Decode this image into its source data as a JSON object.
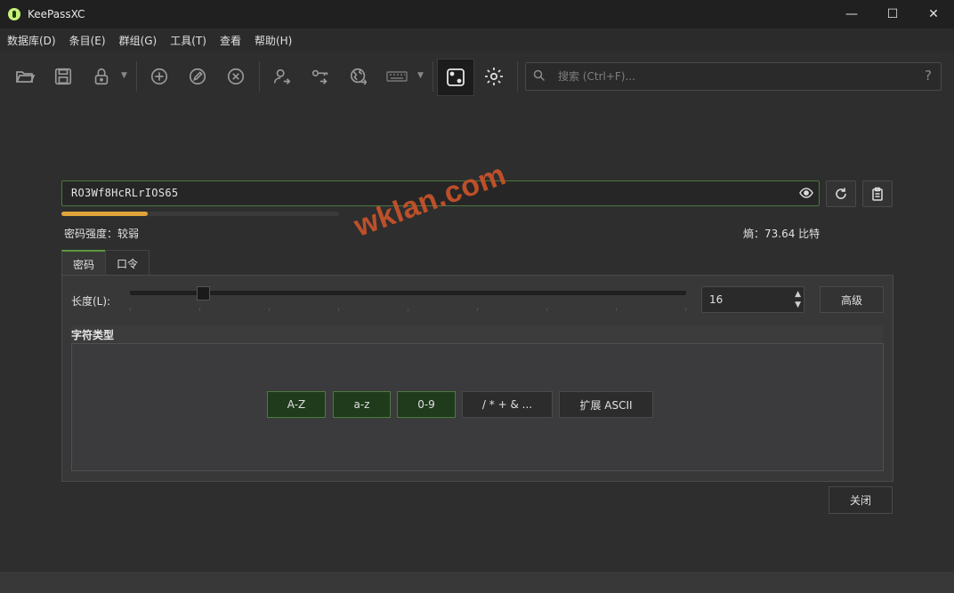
{
  "window": {
    "title": "KeePassXC",
    "minimize": "—",
    "maximize": "☐",
    "close": "✕"
  },
  "menu": [
    "数据库(D)",
    "条目(E)",
    "群组(G)",
    "工具(T)",
    "查看",
    "帮助(H)"
  ],
  "toolbar": {
    "icons": [
      "folder-open-icon",
      "save-icon",
      "lock-icon",
      "add-entry-icon",
      "edit-entry-icon",
      "delete-entry-icon",
      "copy-username-icon",
      "copy-password-icon",
      "open-url-icon",
      "autotype-keyboard-icon",
      "password-generator-icon",
      "settings-icon"
    ],
    "active": "password-generator-icon"
  },
  "search": {
    "placeholder": "搜索 (Ctrl+F)...",
    "help": "?"
  },
  "generator": {
    "password": "RO3Wf8HcRLrIOS65",
    "strength_label": "密码强度：较弱",
    "strength_fraction": 0.31,
    "entropy_label": "熵：73.64 比特",
    "watermark": "wklan.com",
    "tabs": [
      "密码",
      "口令"
    ],
    "active_tab": "密码",
    "length_label": "长度(L):",
    "length_value": "16",
    "length_fraction": 0.13,
    "advanced_label": "高级",
    "charset_title": "字符类型",
    "charsets": [
      {
        "label": "A-Z",
        "on": true
      },
      {
        "label": "a-z",
        "on": true
      },
      {
        "label": "0-9",
        "on": true
      },
      {
        "label": "/ * + & ...",
        "on": false
      },
      {
        "label": "扩展 ASCII",
        "on": false
      }
    ],
    "close_label": "关闭"
  },
  "colors": {
    "accent_green": "#4c7a3e",
    "strength_orange": "#e0a43a",
    "watermark": "#c9532a"
  }
}
